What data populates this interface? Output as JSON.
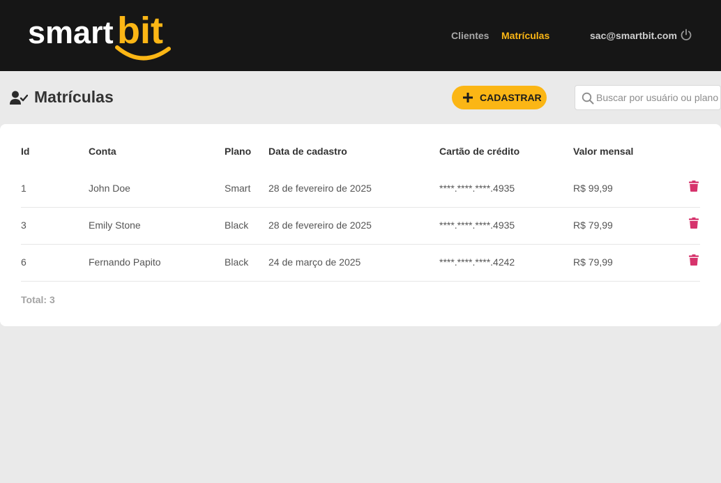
{
  "brand": {
    "logo_part1": "smart",
    "logo_part2": "bit",
    "accent_color": "#fbb615"
  },
  "nav": {
    "items": [
      {
        "label": "Clientes",
        "active": false
      },
      {
        "label": "Matrículas",
        "active": true
      }
    ],
    "user_email": "sac@smartbit.com",
    "logout_icon": "power-icon"
  },
  "page": {
    "title": "Matrículas",
    "title_icon": "user-check-icon",
    "add_button_label": "CADASTRAR",
    "search_placeholder": "Buscar por usuário ou plano"
  },
  "table": {
    "headers": [
      "Id",
      "Conta",
      "Plano",
      "Data de cadastro",
      "Cartão de crédito",
      "Valor mensal"
    ],
    "rows": [
      {
        "id": "1",
        "conta": "John Doe",
        "plano": "Smart",
        "data": "28 de fevereiro de 2025",
        "cartao": "****.****.****.4935",
        "valor": "R$ 99,99"
      },
      {
        "id": "3",
        "conta": "Emily Stone",
        "plano": "Black",
        "data": "28 de fevereiro de 2025",
        "cartao": "****.****.****.4935",
        "valor": "R$ 79,99"
      },
      {
        "id": "6",
        "conta": "Fernando Papito",
        "plano": "Black",
        "data": "24 de março de 2025",
        "cartao": "****.****.****.4242",
        "valor": "R$ 79,99"
      }
    ],
    "delete_icon": "trash-icon",
    "delete_color": "#d6336c",
    "total": "Total: 3"
  }
}
